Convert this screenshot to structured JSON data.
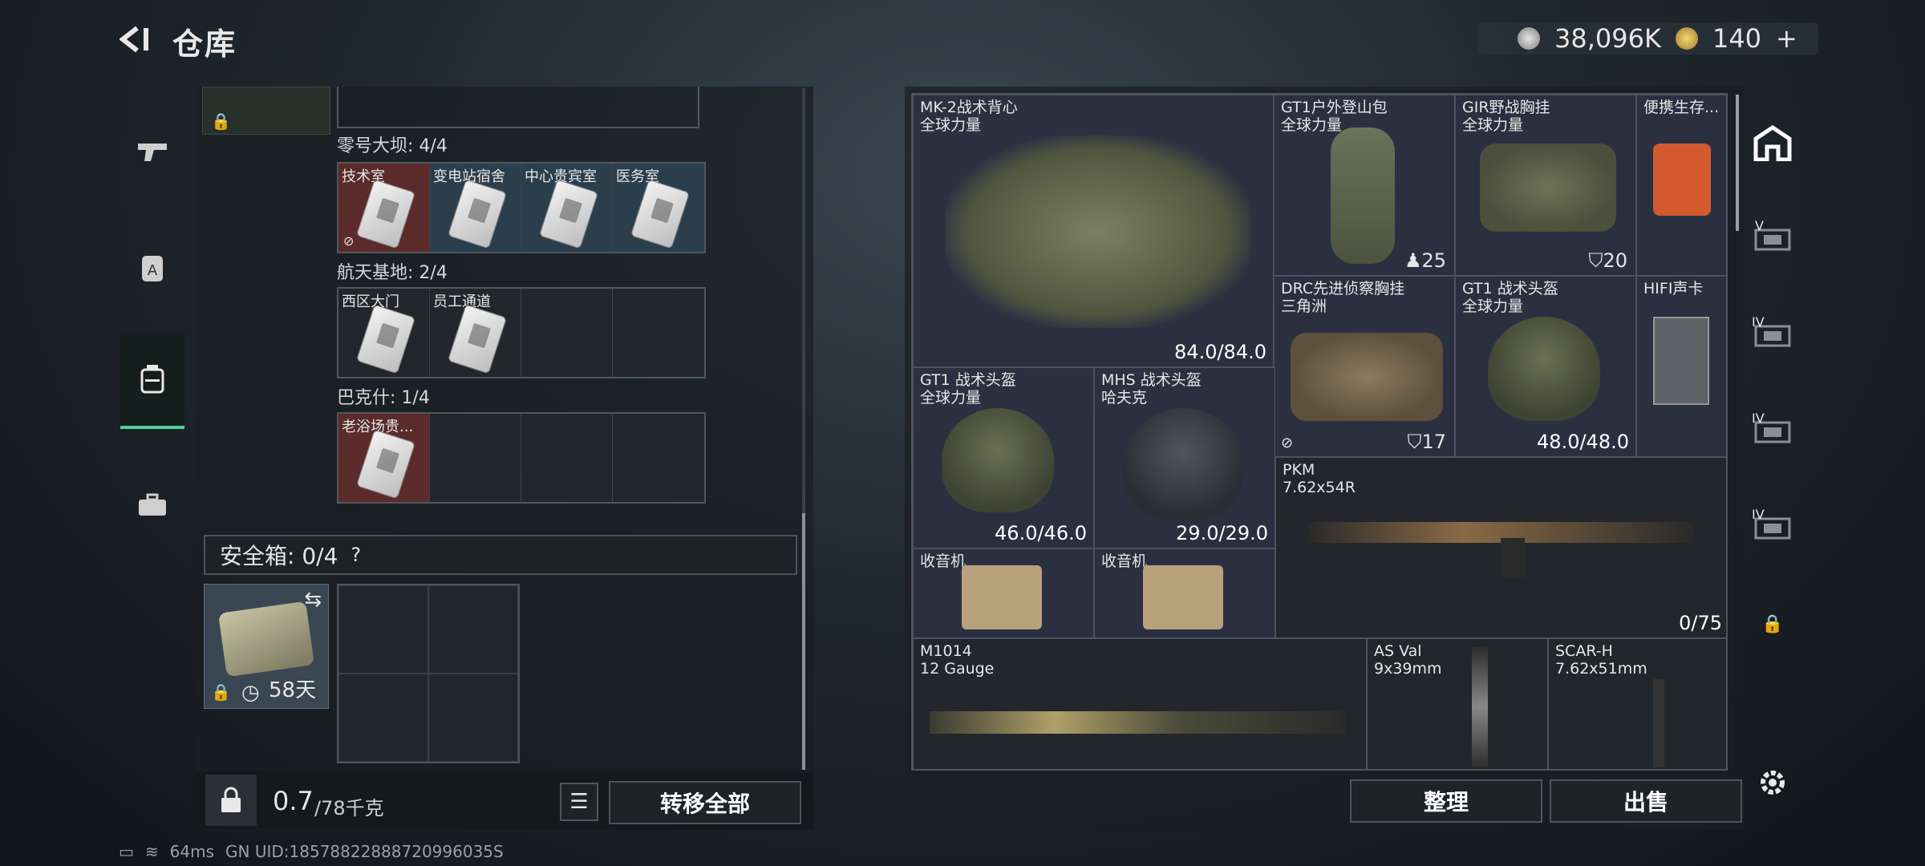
{
  "header": {
    "title": "仓库"
  },
  "currency": {
    "silver": "38,096K",
    "gold": "140",
    "gold_plus": "+"
  },
  "left": {
    "groups": [
      {
        "label": "零号大坝: 4/4",
        "slots": [
          {
            "name": "技术室",
            "color": "red"
          },
          {
            "name": "变电站宿舍",
            "color": "blue"
          },
          {
            "name": "中心贵宾室",
            "color": "blue"
          },
          {
            "name": "医务室",
            "color": "blue"
          }
        ]
      },
      {
        "label": "航天基地: 2/4",
        "slots": [
          {
            "name": "西区大门",
            "color": "grey"
          },
          {
            "name": "员工通道",
            "color": "grey"
          },
          {
            "name": "",
            "color": "grey"
          },
          {
            "name": "",
            "color": "grey"
          }
        ]
      },
      {
        "label": "巴克什: 1/4",
        "slots": [
          {
            "name": "老浴场贵...",
            "color": "red"
          },
          {
            "name": "",
            "color": "grey"
          },
          {
            "name": "",
            "color": "grey"
          },
          {
            "name": "",
            "color": "grey"
          }
        ]
      }
    ],
    "safebox": {
      "label": "安全箱: 0/4",
      "help": "?",
      "duration": "58天"
    },
    "footer": {
      "weight_current": "0.7",
      "weight_max": "/78千克",
      "transfer_all": "转移全部"
    }
  },
  "inventory": {
    "items": [
      {
        "id": "vest",
        "name": "MK-2战术背心",
        "sub": "全球力量",
        "value": "84.0/84.0"
      },
      {
        "id": "backpack1",
        "name": "GT1户外登山包",
        "sub": "全球力量",
        "badge": "25"
      },
      {
        "id": "chestrig1",
        "name": "GIR野战胸挂",
        "sub": "全球力量",
        "badge": "20"
      },
      {
        "id": "survival",
        "name": "便携生存...",
        "sub": ""
      },
      {
        "id": "chestrig2",
        "name": "DRC先进侦察胸挂",
        "sub": "三角洲",
        "badge": "17"
      },
      {
        "id": "helmet3",
        "name": "GT1 战术头盔",
        "sub": "全球力量",
        "value": "48.0/48.0"
      },
      {
        "id": "soundcard",
        "name": "HIFI声卡",
        "sub": ""
      },
      {
        "id": "helmet1",
        "name": "GT1 战术头盔",
        "sub": "全球力量",
        "value": "46.0/46.0"
      },
      {
        "id": "helmet2",
        "name": "MHS 战术头盔",
        "sub": "哈夫克",
        "value": "29.0/29.0"
      },
      {
        "id": "pkm",
        "name": "PKM",
        "sub": "7.62x54R",
        "value": "0/75"
      },
      {
        "id": "radio1",
        "name": "收音机",
        "sub": ""
      },
      {
        "id": "radio2",
        "name": "收音机",
        "sub": ""
      },
      {
        "id": "m1014",
        "name": "M1014",
        "sub": "12 Gauge"
      },
      {
        "id": "asval",
        "name": "AS Val",
        "sub": "9x39mm"
      },
      {
        "id": "scarh",
        "name": "SCAR-H",
        "sub": "7.62x51mm"
      }
    ],
    "buttons": {
      "organize": "整理",
      "sell": "出售"
    }
  },
  "right_rail": {
    "tiers": [
      "V",
      "IV",
      "IV",
      "IV"
    ]
  },
  "status_bar": {
    "ping": "64ms",
    "uid": "GN UID:18578822888720996035S"
  }
}
